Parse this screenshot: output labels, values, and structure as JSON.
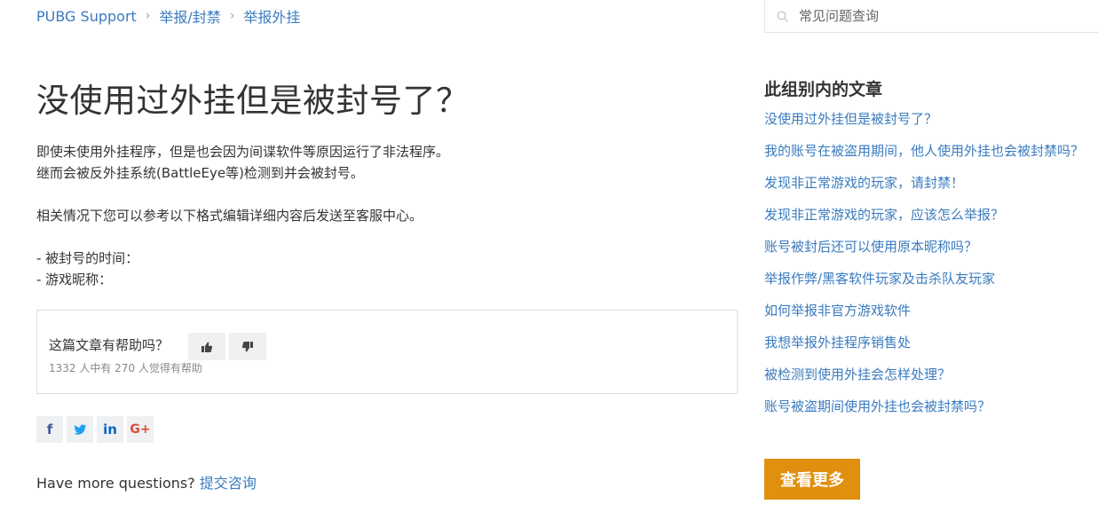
{
  "breadcrumb": {
    "items": [
      "PUBG Support",
      "举报/封禁",
      "举报外挂"
    ],
    "separator": "›"
  },
  "search": {
    "placeholder": "常见问题查询",
    "icon": "search-icon"
  },
  "article": {
    "title": "没使用过外挂但是被封号了？",
    "paragraphs": [
      "即使未使用外挂程序，但是也会因为间谍软件等原因运行了非法程序。",
      "继而会被反外挂系统(BattleEye等)检测到并会被封号。",
      "",
      "相关情况下您可以参考以下格式编辑详细内容后发送至客服中心。",
      "",
      "- 被封号的时间：",
      "- 游戏昵称："
    ]
  },
  "vote": {
    "question": "这篇文章有帮助吗？",
    "count_text": "1332 人中有 270 人觉得有帮助",
    "up_icon": "thumbs-up-icon",
    "down_icon": "thumbs-down-icon"
  },
  "share": {
    "facebook": "f",
    "twitter": "twitter-bird-icon",
    "linkedin": "in",
    "googleplus": "G+"
  },
  "more_questions": {
    "text": "Have more questions?",
    "link": "提交咨询"
  },
  "sidebar": {
    "title": "此组别内的文章",
    "articles": [
      "没使用过外挂但是被封号了？",
      "我的账号在被盗用期间，他人使用外挂也会被封禁吗？",
      "发现非正常游戏的玩家，请封禁！",
      "发现非正常游戏的玩家，应该怎么举报？",
      "账号被封后还可以使用原本昵称吗？",
      "举报作弊/黑客软件玩家及击杀队友玩家",
      "如何举报非官方游戏软件",
      "我想举报外挂程序销售处",
      "被检测到使用外挂会怎样处理？",
      "账号被盗期间使用外挂也会被封禁吗？"
    ],
    "see_more": "查看更多"
  },
  "colors": {
    "link": "#3a7bbf",
    "button": "#e08f0e",
    "text": "#333333"
  }
}
